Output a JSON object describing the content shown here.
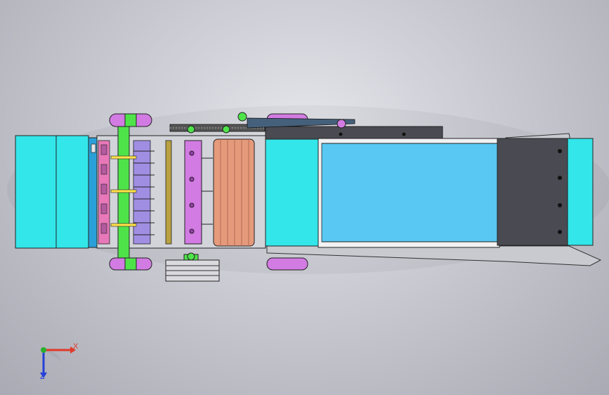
{
  "viewport": {
    "model": "machine-assembly-top-view",
    "colors": {
      "cyan": "#33e6ea",
      "conveyor_blue": "#59c8f2",
      "magenta": "#d27be2",
      "green": "#4fe34a",
      "copper": "#e59a7c",
      "dark_plate": "#4a4b52",
      "outline": "#222222",
      "olive": "#b8a140",
      "lavender": "#9f8ee2",
      "pink": "#e878b9"
    }
  },
  "triad": {
    "x_label": "X",
    "z_label": "Z",
    "x_color": "#e03a2a",
    "y_color": "#2bb02b",
    "z_color": "#2540d8"
  }
}
